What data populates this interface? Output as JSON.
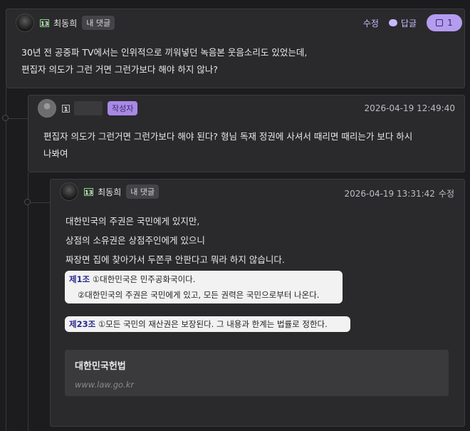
{
  "comments": [
    {
      "level": "13",
      "author": "최동희",
      "badge": "내 댓글",
      "actions": {
        "edit": "수정",
        "reply": "답글",
        "likes": "1"
      },
      "lines": [
        "30년 전 공중파 TV에서는 인위적으로 끼워넣던 녹음본 웃음소리도 있었는데,",
        "편집자 의도가 그런 거면 그런가보다 해야 하지 않나?"
      ]
    },
    {
      "level": "1",
      "badge": "작성자",
      "timestamp": "2026-04-19 12:49:40",
      "lines": [
        "편집자 의도가 그런거면 그런가보다 해야 된다? 형님 독재 정권에 사셔서 때리면 때리는가 보다 하시",
        "나봐여"
      ]
    },
    {
      "level": "13",
      "author": "최동희",
      "badge": "내 댓글",
      "timestamp": "2026-04-19 13:31:42",
      "edit": "수정",
      "lines": [
        "대한민국의 주권은 국민에게 있지만,",
        "상점의 소유권은 상점주인에게 있으니",
        "짜장면 집에 찾아가서 두쫀쿠 안판다고 뭐라 하지 않습니다."
      ],
      "law1": {
        "article": "제1조",
        "line1": "①대한민국은 민주공화국이다.",
        "line2": "②대한민국의 주권은 국민에게 있고, 모든 권력은 국민으로부터 나온다."
      },
      "law2": {
        "article": "제23조",
        "text": "①모든 국민의 재산권은 보장된다. 그 내용과 한계는 법률로 정한다."
      },
      "preview": {
        "title": "대한민국헌법",
        "url": "www.law.go.kr"
      }
    }
  ]
}
